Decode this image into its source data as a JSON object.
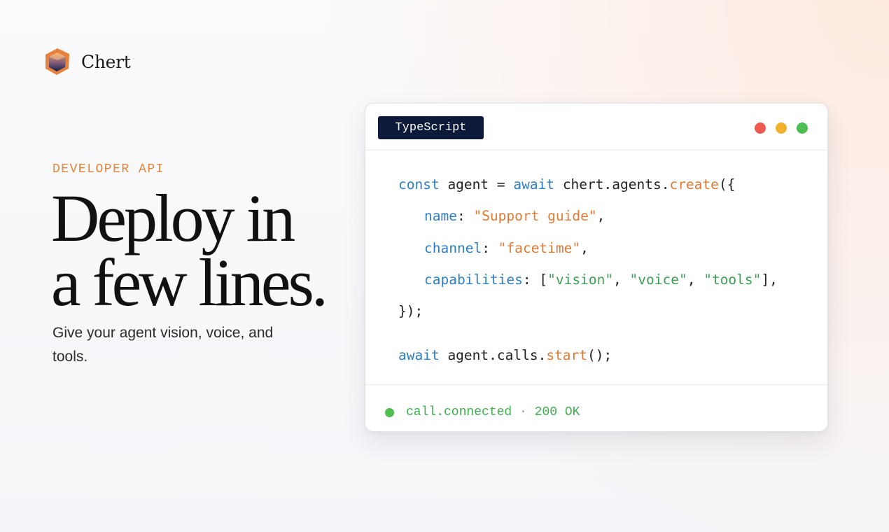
{
  "brand": {
    "name": "Chert",
    "logo_icon": "hexagon-gem-logo-icon"
  },
  "hero": {
    "eyebrow": "DEVELOPER API",
    "title_line1": "Deploy in",
    "title_line2": "a few lines.",
    "subtitle": "Give your agent vision, voice, and tools."
  },
  "code_card": {
    "language_tab": "TypeScript",
    "window_controls": [
      "close-dot",
      "minimize-dot",
      "maximize-dot"
    ],
    "code": {
      "line1": {
        "kw1": "const",
        "t1": " agent = ",
        "kw2": "await",
        "t2": " chert.agents.",
        "fn": "create",
        "t3": "({"
      },
      "line2": {
        "prop": "name",
        "sep": ": ",
        "str": "\"Support guide\"",
        "end": ","
      },
      "line3": {
        "prop": "channel",
        "sep": ": ",
        "str": "\"facetime\"",
        "end": ","
      },
      "line4": {
        "prop": "capabilities",
        "sep": ": [",
        "s1": "\"vision\"",
        "c1": ", ",
        "s2": "\"voice\"",
        "c2": ", ",
        "s3": "\"tools\"",
        "end": "],"
      },
      "line5": {
        "text": "});"
      },
      "line6": {
        "kw": "await",
        "t1": " agent.calls.",
        "fn": "start",
        "t2": "();"
      }
    },
    "status": {
      "event": "call.connected",
      "separator": " · ",
      "code": "200 OK"
    }
  },
  "colors": {
    "accent_orange": "#e07a35",
    "keyword_blue": "#2f7fc4",
    "string_green": "#3a9f52",
    "tab_navy": "#0e1a3a",
    "status_green": "#4ebd52"
  }
}
